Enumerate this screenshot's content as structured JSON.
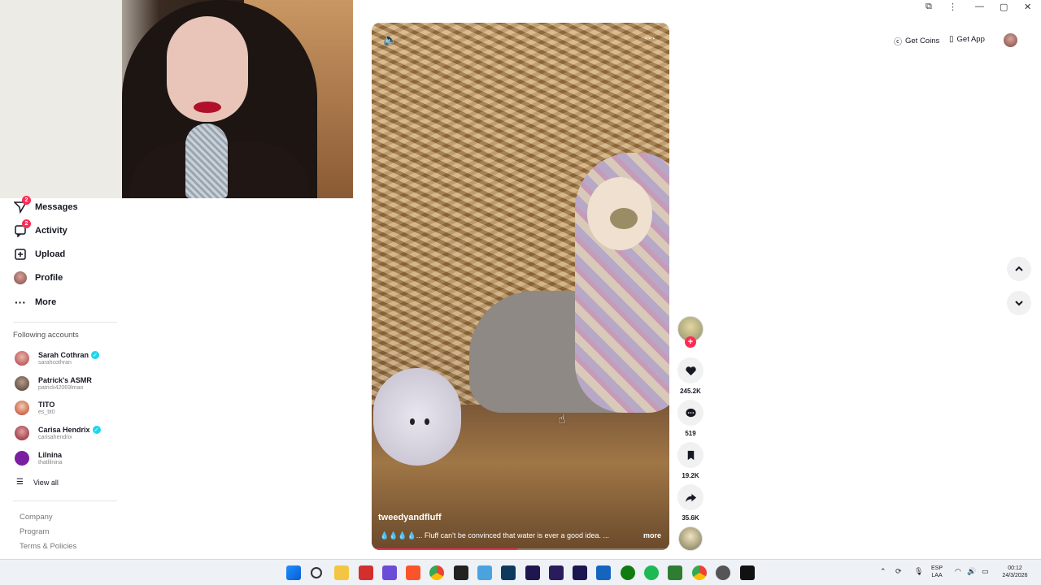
{
  "window": {
    "minimize": "—",
    "maximize": "▢",
    "close": "✕"
  },
  "header": {
    "get_coins": "Get Coins",
    "get_app": "Get App"
  },
  "sidebar": {
    "items": [
      {
        "label": "Messages",
        "badge": "2"
      },
      {
        "label": "Activity",
        "badge": "2"
      },
      {
        "label": "Upload"
      },
      {
        "label": "Profile"
      },
      {
        "label": "More"
      }
    ],
    "following_title": "Following accounts",
    "accounts": [
      {
        "name": "Sarah Cothran",
        "handle": "sarahcothran",
        "verified": true,
        "color": "#b23a48"
      },
      {
        "name": "Patrick's ASMR",
        "handle": "patrick42069lmao",
        "verified": false,
        "color": "#4a3b32"
      },
      {
        "name": "TITO",
        "handle": "es_tit0",
        "verified": false,
        "color": "#c0392b"
      },
      {
        "name": "Carisa Hendrix",
        "handle": "carisahendrix",
        "verified": true,
        "color": "#8e1b2e"
      },
      {
        "name": "Lilnina",
        "handle": "thatlilnina",
        "verified": false,
        "color": "#7b1fa2"
      }
    ],
    "view_all": "View all",
    "footer": [
      "Company",
      "Program",
      "Terms & Policies"
    ]
  },
  "video": {
    "username": "tweedyandfluff",
    "caption": "💧💧💧💧... Fluff can't be convinced that water is ever a good idea. ...",
    "more": "more",
    "progress": 0.49
  },
  "actions": {
    "likes": "245.2K",
    "comments": "519",
    "saves": "19.2K",
    "shares": "35.6K"
  },
  "taskbar": {
    "lang": "ESP",
    "region": "LAA",
    "time": "00:12",
    "date": "24/3/2026"
  },
  "colors": {
    "accent": "#fe2c55",
    "verified": "#20d5ec"
  }
}
